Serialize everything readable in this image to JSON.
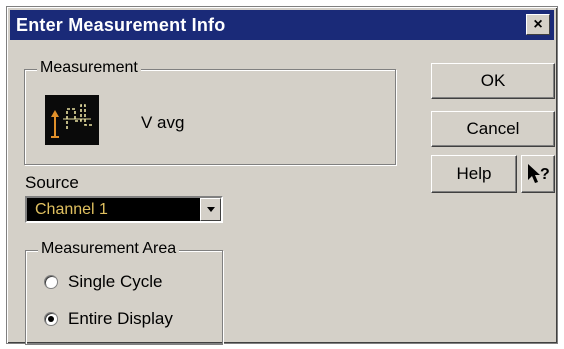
{
  "window": {
    "title": "Enter Measurement Info",
    "close_label": "×"
  },
  "measurement": {
    "group_label": "Measurement",
    "value": "V avg",
    "icon": "voltage-average-waveform-icon"
  },
  "source": {
    "label": "Source",
    "selected": "Channel 1"
  },
  "area": {
    "group_label": "Measurement Area",
    "options": [
      {
        "label": "Single Cycle",
        "selected": false
      },
      {
        "label": "Entire Display",
        "selected": true
      }
    ]
  },
  "buttons": {
    "ok": "OK",
    "cancel": "Cancel",
    "help": "Help",
    "whats_this_icon": "pointer-question-icon"
  },
  "colors": {
    "titlebar": "#1a2a78",
    "face": "#d4d0c8",
    "select_bg": "#000000",
    "select_text": "#e0c060",
    "waveform": "#e8e0a0",
    "waveform_marker": "#e0902a"
  }
}
